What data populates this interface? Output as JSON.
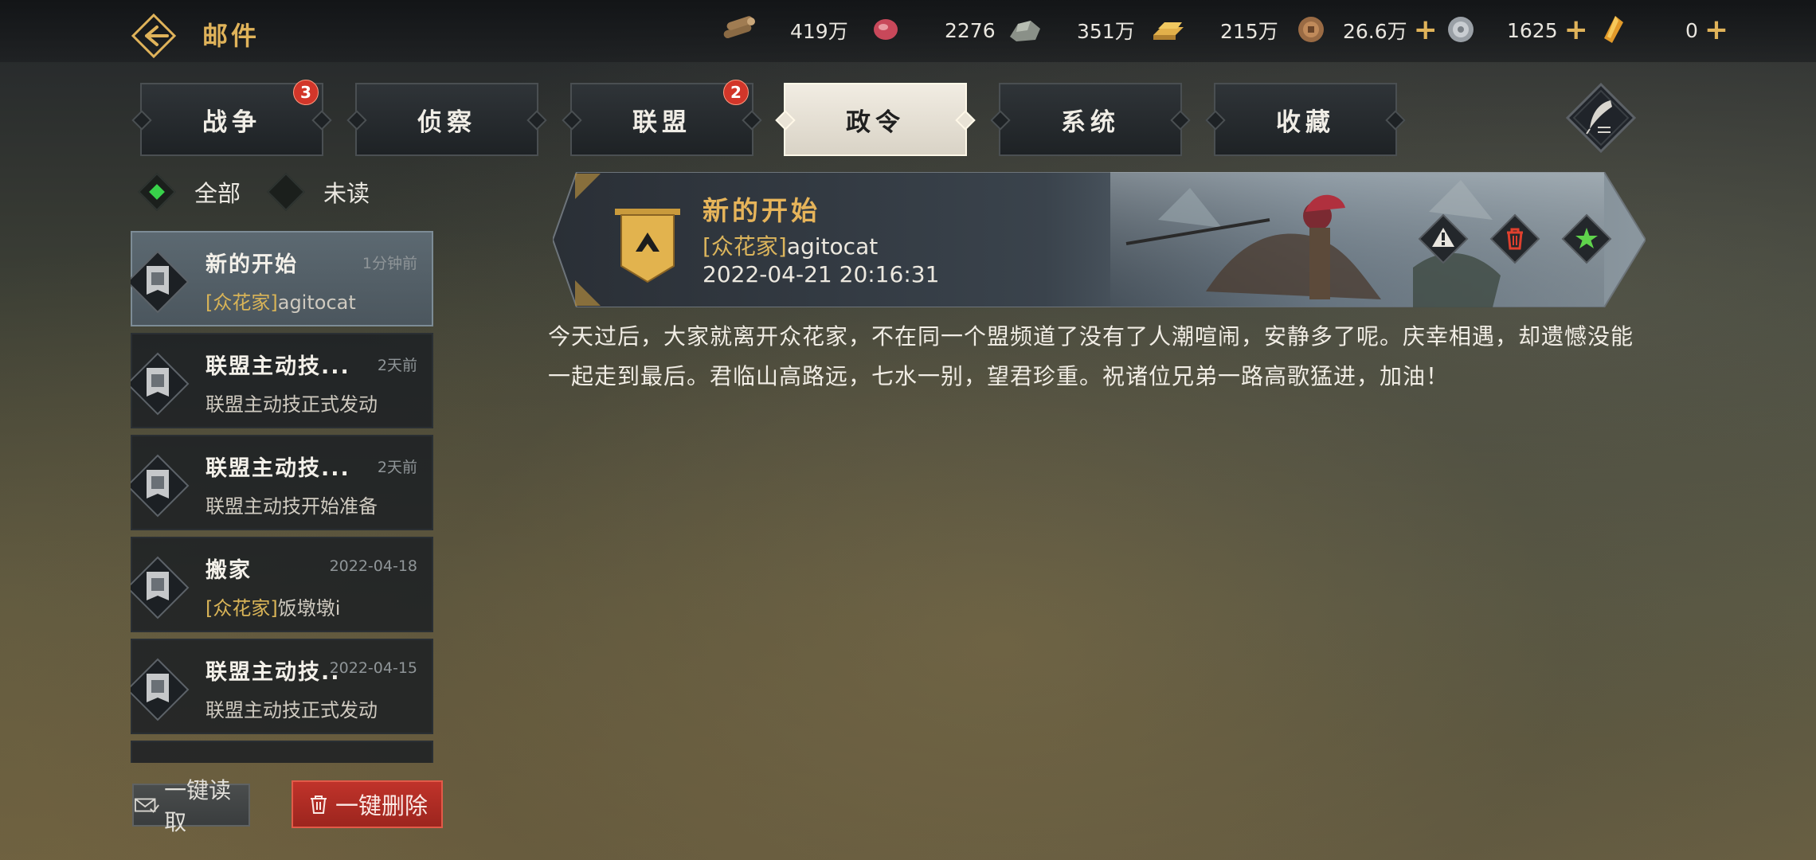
{
  "header": {
    "title": "邮件",
    "resources": [
      {
        "icon": "wood-icon",
        "value": "419万",
        "plus": false
      },
      {
        "icon": "meat-icon",
        "value": "2276",
        "plus": false
      },
      {
        "icon": "iron-ore-icon",
        "value": "351万",
        "plus": false
      },
      {
        "icon": "gold-bar-icon",
        "value": "215万",
        "plus": false
      },
      {
        "icon": "copper-coin-icon",
        "value": "26.6万",
        "plus": true
      },
      {
        "icon": "silver-coin-icon",
        "value": "1625",
        "plus": true
      },
      {
        "icon": "amber-crystal-icon",
        "value": "0",
        "plus": true
      }
    ]
  },
  "tabs": [
    {
      "label": "战争",
      "badge": "3",
      "active": false
    },
    {
      "label": "侦察",
      "badge": "",
      "active": false
    },
    {
      "label": "联盟",
      "badge": "2",
      "active": false
    },
    {
      "label": "政令",
      "badge": "",
      "active": true
    },
    {
      "label": "系统",
      "badge": "",
      "active": false
    },
    {
      "label": "收藏",
      "badge": "",
      "active": false
    }
  ],
  "filters": [
    {
      "label": "全部",
      "selected": true
    },
    {
      "label": "未读",
      "selected": false
    }
  ],
  "mails": [
    {
      "title": "新的开始",
      "time": "1分钟前",
      "tag": "[众花家]",
      "sub": "agitocat",
      "selected": true
    },
    {
      "title": "联盟主动技...",
      "time": "2天前",
      "tag": "",
      "sub": "联盟主动技正式发动",
      "selected": false
    },
    {
      "title": "联盟主动技...",
      "time": "2天前",
      "tag": "",
      "sub": "联盟主动技开始准备",
      "selected": false
    },
    {
      "title": "搬家",
      "time": "2022-04-18",
      "tag": "[众花家]",
      "sub": "饭墩墩i",
      "selected": false
    },
    {
      "title": "联盟主动技..",
      "time": "2022-04-15",
      "tag": "",
      "sub": "联盟主动技正式发动",
      "selected": false
    }
  ],
  "actions": {
    "read_all": "一键读取",
    "delete_all": "一键删除"
  },
  "detail": {
    "title": "新的开始",
    "sender_tag": "[众花家]",
    "sender_name": "agitocat",
    "datetime": "2022-04-21 20:16:31",
    "body": "今天过后，大家就离开众花家，不在同一个盟频道了没有了人潮喧闹，安静多了呢。庆幸相遇，却遗憾没能一起走到最后。君临山高路远，七水一别，望君珍重。祝诸位兄弟一路高歌猛进，加油！"
  },
  "colors": {
    "accent_gold": "#e0b35a",
    "badge_red": "#d2362a",
    "delete_red": "#b02c24",
    "filter_green": "#38d14a"
  }
}
